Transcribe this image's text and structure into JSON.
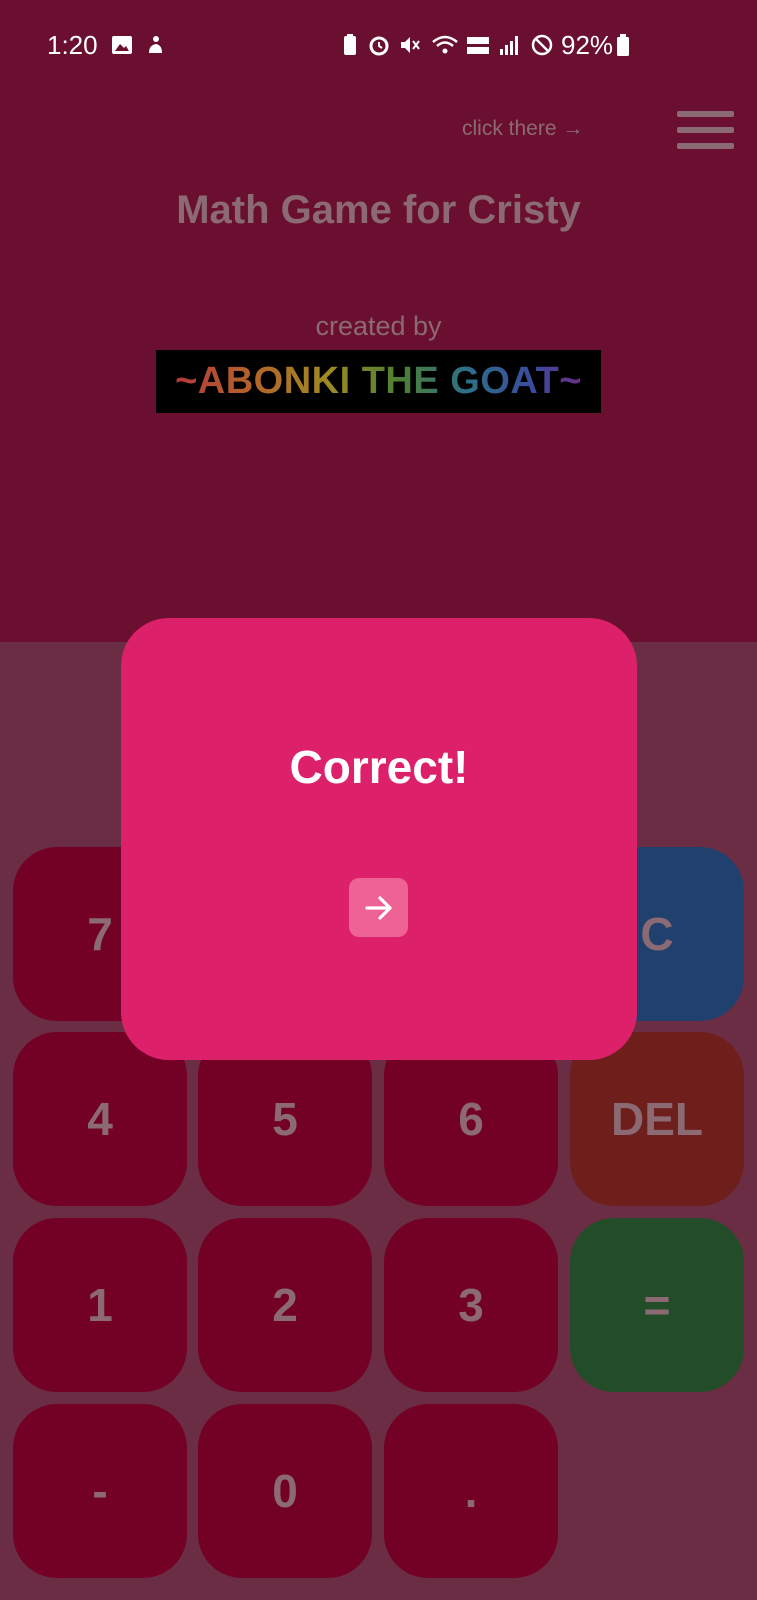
{
  "status_bar": {
    "time": "1:20",
    "battery": "92%"
  },
  "header": {
    "hint": "click there →",
    "title": "Math Game for Cristy",
    "created_by": "created by",
    "author": "~ABONKI THE GOAT~"
  },
  "keypad": {
    "keys": [
      "7",
      "C",
      "4",
      "5",
      "6",
      "DEL",
      "1",
      "2",
      "3",
      "=",
      "-",
      "0",
      "."
    ]
  },
  "dialog": {
    "message": "Correct!",
    "next_icon": "arrow-right-icon"
  },
  "colors": {
    "header_bg": "#6a0f2f",
    "body_bg": "#6b2d44",
    "key_bg": "#730025",
    "dialog_bg": "#dc216a",
    "clear_bg": "#20406e",
    "del_bg": "#6e1f1c",
    "equals_bg": "#234d28"
  }
}
